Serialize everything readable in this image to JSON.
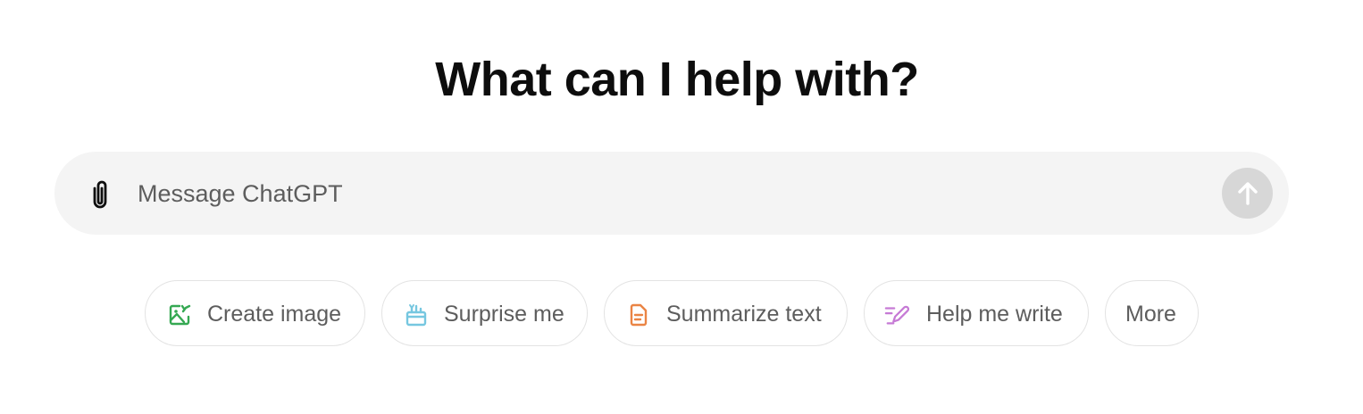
{
  "heading": "What can I help with?",
  "composer": {
    "placeholder": "Message ChatGPT",
    "value": "",
    "attach_icon": "paperclip-icon",
    "send_icon": "arrow-up-icon"
  },
  "suggestions": [
    {
      "label": "Create image",
      "icon": "image-icon",
      "color": "#35a852"
    },
    {
      "label": "Surprise me",
      "icon": "gift-icon",
      "color": "#76c7e0"
    },
    {
      "label": "Summarize text",
      "icon": "document-icon",
      "color": "#ea8444"
    },
    {
      "label": "Help me write",
      "icon": "pen-icon",
      "color": "#c67ad5"
    },
    {
      "label": "More",
      "icon": "",
      "color": ""
    }
  ],
  "colors": {
    "composer_bg": "#f4f4f4",
    "send_bg": "#d7d7d7",
    "chip_border": "#e3e3e3",
    "chip_text": "#5d5d5d"
  }
}
